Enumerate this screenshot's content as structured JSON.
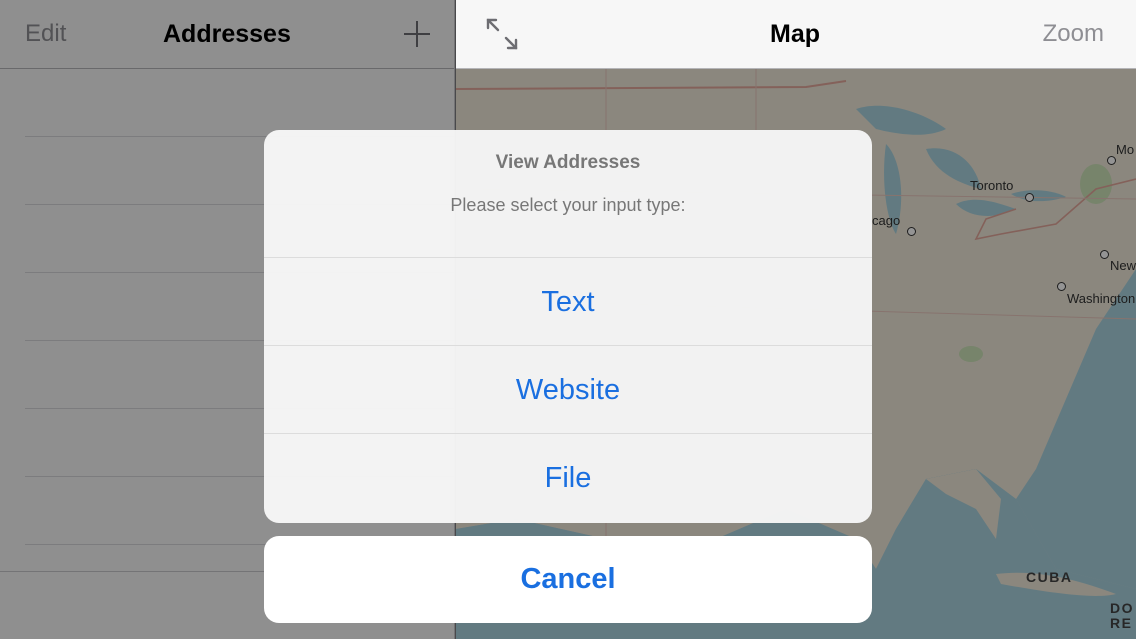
{
  "left_nav": {
    "edit_label": "Edit",
    "title": "Addresses",
    "add_icon": "plus-icon"
  },
  "right_nav": {
    "title": "Map",
    "zoom_label": "Zoom",
    "expand_icon": "expand-arrows-icon"
  },
  "map": {
    "labels": [
      "Toronto",
      "cago",
      "Mo",
      "New",
      "Washington",
      "CUBA",
      "DO",
      "RE"
    ]
  },
  "action_sheet": {
    "title": "View Addresses",
    "message": "Please select your input type:",
    "actions": [
      {
        "label": "Text"
      },
      {
        "label": "Website"
      },
      {
        "label": "File"
      }
    ],
    "cancel_label": "Cancel"
  },
  "colors": {
    "accent": "#1a6fe0",
    "nav_bg": "#f7f7f7",
    "water": "#a9d3df"
  }
}
